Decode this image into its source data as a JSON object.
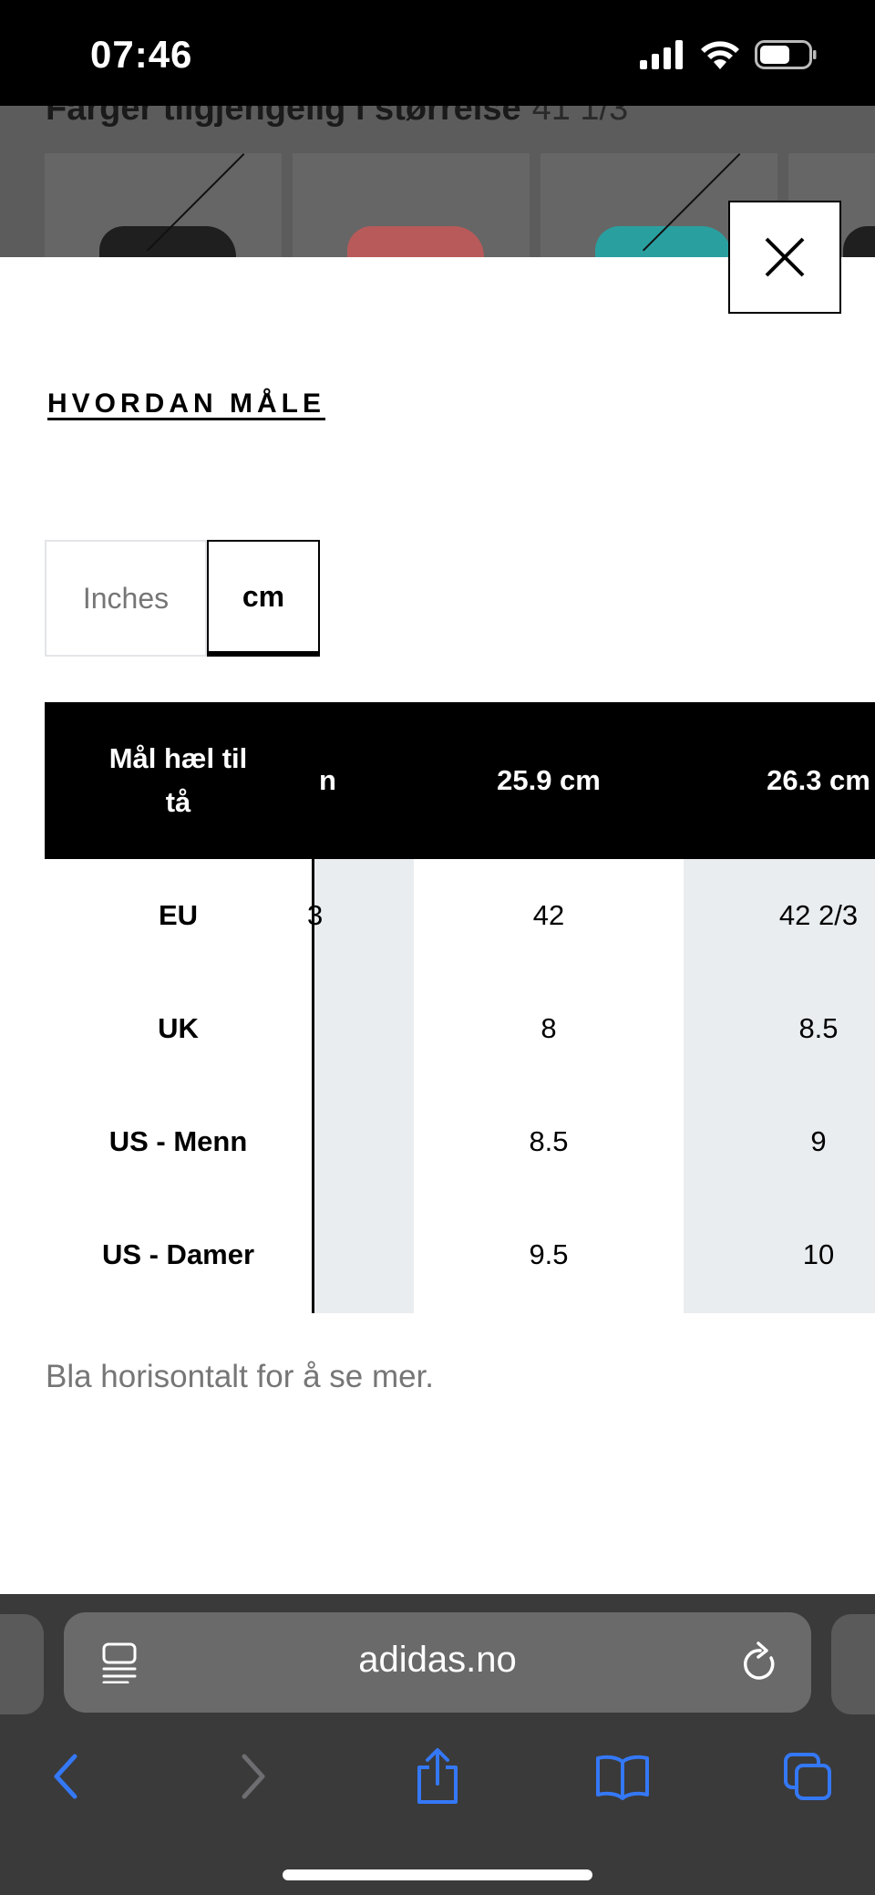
{
  "status": {
    "time": "07:46"
  },
  "background_page": {
    "heading": "Farger tilgjengelig i størrelse",
    "size": "41 1/3",
    "swatches": [
      {
        "color_name": "black",
        "shoe_color": "#1f1f1f"
      },
      {
        "color_name": "red",
        "shoe_color": "#c04a4a"
      },
      {
        "color_name": "turquoise",
        "shoe_color": "#2a9fa0"
      }
    ]
  },
  "modal": {
    "measure_link": "HVORDAN MÅLE",
    "units": {
      "inches": "Inches",
      "cm": "cm",
      "selected": "cm"
    },
    "table": {
      "header_label": "Mål hæl til tå",
      "columns": [
        "n",
        "25.9 cm",
        "26.3 cm"
      ],
      "rows": [
        {
          "label": "EU",
          "values": [
            "3",
            "42",
            "42 2/3"
          ]
        },
        {
          "label": "UK",
          "values": [
            "",
            "8",
            "8.5"
          ]
        },
        {
          "label": "US - Menn",
          "values": [
            "",
            "8.5",
            "9"
          ]
        },
        {
          "label": "US - Damer",
          "values": [
            "",
            "9.5",
            "10"
          ]
        }
      ]
    },
    "hint": "Bla horisontalt for å se mer."
  },
  "browser": {
    "url": "adidas.no",
    "accent": "#3478f6"
  }
}
